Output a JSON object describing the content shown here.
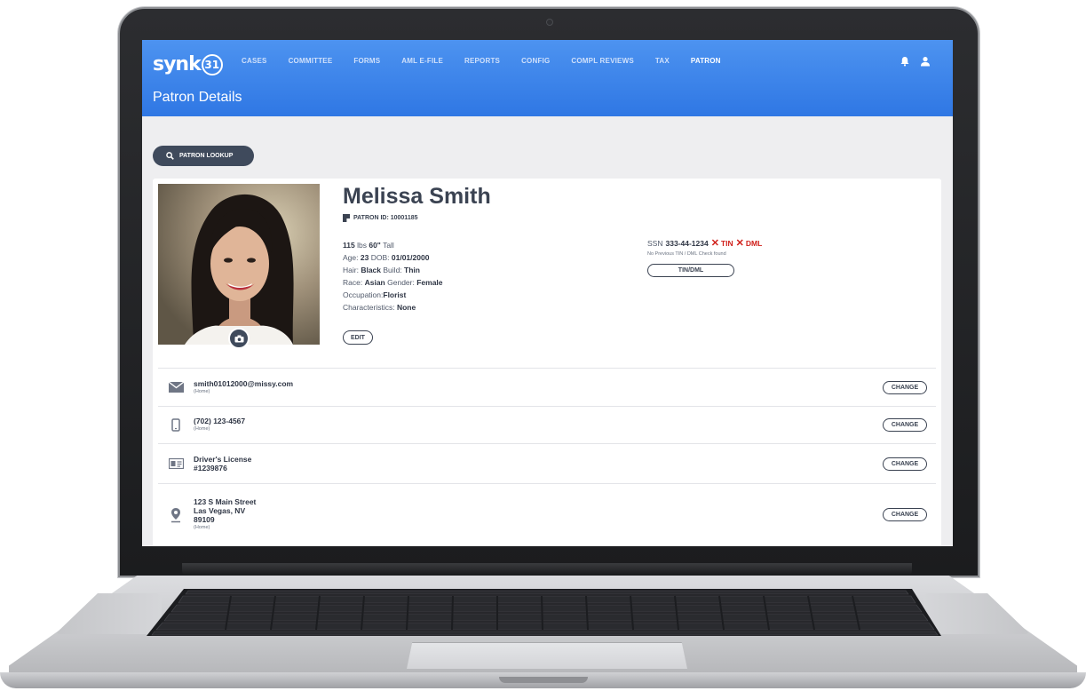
{
  "app": {
    "logo_text": "synk",
    "logo_number": "31",
    "page_title": "Patron Details"
  },
  "nav": {
    "items": [
      {
        "label": "CASES",
        "active": false
      },
      {
        "label": "COMMITTEE",
        "active": false
      },
      {
        "label": "FORMS",
        "active": false
      },
      {
        "label": "AML E-FILE",
        "active": false
      },
      {
        "label": "REPORTS",
        "active": false
      },
      {
        "label": "CONFIG",
        "active": false
      },
      {
        "label": "COMPL REVIEWS",
        "active": false
      },
      {
        "label": "TAX",
        "active": false
      },
      {
        "label": "PATRON",
        "active": true
      }
    ],
    "icons": [
      "bell-icon",
      "user-icon"
    ]
  },
  "toolbar": {
    "lookup_label": "PATRON LOOKUP",
    "lookup_icon": "search-icon"
  },
  "patron": {
    "name": "Melissa Smith",
    "id_label": "PATRON ID: 10001185",
    "weight": "115",
    "weight_unit": "lbs",
    "height": "60\"",
    "height_suffix": "Tall",
    "age_label": "Age:",
    "age": "23",
    "dob_label": "DOB:",
    "dob": "01/01/2000",
    "hair_label": "Hair:",
    "hair": "Black",
    "build_label": "Build:",
    "build": "Thin",
    "race_label": "Race:",
    "race": "Asian",
    "gender_label": "Gender:",
    "gender": "Female",
    "occupation_label": "Occupation:",
    "occupation": "Florist",
    "characteristics_label": "Characteristics:",
    "characteristics": "None",
    "edit_label": "EDIT",
    "ssn_label": "SSN",
    "ssn": "333-44-1234",
    "tin_flag": "TIN",
    "dml_flag": "DML",
    "ssn_note": "No Previous TIN / DML Check found",
    "tin_button": "TIN/DML"
  },
  "contacts": [
    {
      "icon": "mail-icon",
      "line1": "smith01012000@missy.com",
      "line2": "",
      "line3": "",
      "sub": "(Home)",
      "button": "CHANGE"
    },
    {
      "icon": "phone-icon",
      "line1": "(702) 123-4567",
      "line2": "",
      "line3": "",
      "sub": "(Home)",
      "button": "CHANGE"
    },
    {
      "icon": "id-card-icon",
      "line1": "Driver's License",
      "line2": "#1239876",
      "line3": "",
      "sub": "",
      "button": "CHANGE"
    },
    {
      "icon": "location-pin-icon",
      "line1": "123 S Main Street",
      "line2": "Las Vegas, NV",
      "line3": "89109",
      "sub": "(Home)",
      "button": "CHANGE"
    }
  ],
  "colors": {
    "header_blue": "#3680e9",
    "dark_button": "#3f4a5c",
    "alert_red": "#d0211c",
    "page_bg": "#eeeef0"
  }
}
